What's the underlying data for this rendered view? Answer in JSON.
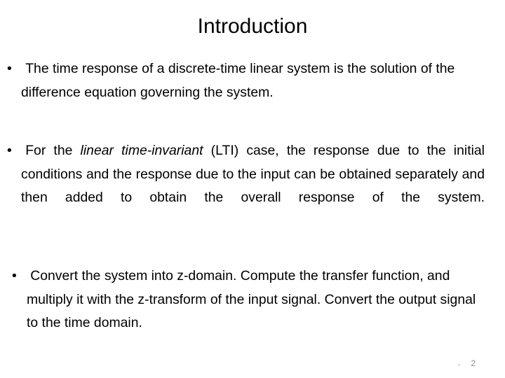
{
  "slide": {
    "title": "Introduction",
    "page_number": "2",
    "background_color": "#ffffff",
    "text_color": "#000000",
    "page_number_color": "#8f8f8f",
    "bullet_marker": "•",
    "bullets": [
      {
        "id": "bullet-time-response",
        "marker": "•",
        "text": "The time response of a discrete-time linear system is the solution of the difference equation governing the system."
      },
      {
        "id": "bullet-lti-superposition",
        "marker": "•",
        "text_before_emphasis": "For the ",
        "emphasis": "linear time-invariant",
        "text_after_emphasis": " (LTI) case, the response due to the initial conditions and the response due to the input can be obtained separately and then added to obtain the overall response of the system."
      },
      {
        "id": "bullet-z-domain",
        "marker": "•",
        "text": "Convert the system into z-domain. Compute the transfer function, and multiply it with the z-transform of the input signal. Convert the output signal to the time domain."
      }
    ]
  }
}
